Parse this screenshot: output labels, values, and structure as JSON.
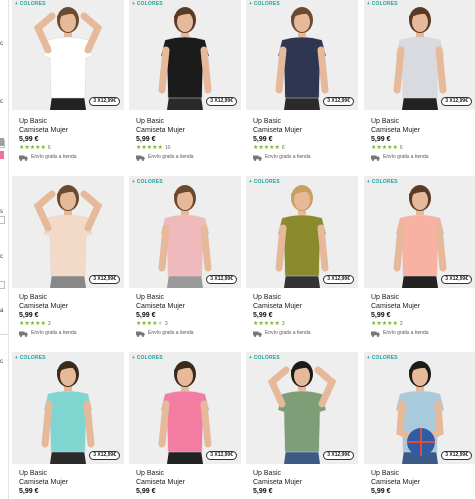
{
  "sidebar": {
    "fragments": [
      {
        "text": "c"
      },
      {
        "text": "c"
      },
      {
        "text": "s"
      },
      {
        "text": "c"
      },
      {
        "text": "a"
      },
      {
        "text": "c"
      }
    ],
    "swatches": [
      "#9e9e9e",
      "#f06ea0"
    ]
  },
  "colors": {
    "accent_green": "#7bb32e",
    "colores_teal": "#1aa6a0",
    "photo_bg": "#eeeeee"
  },
  "products": [
    {
      "colores": "+ COLORES",
      "badge": "3 X12,99€",
      "brand": "Up Basic",
      "name": "Camiseta Mujer",
      "price": "5,99 €",
      "stars": 5,
      "reviews": "6",
      "shipping": "Envío gratis a tienda",
      "shirt": "#ffffff",
      "pants": "#222222",
      "hair": "#6b4a2f",
      "pose": "arms-up"
    },
    {
      "colores": "+ COLORES",
      "badge": "3 X12,99€",
      "brand": "Up Basic",
      "name": "Camiseta Mujer",
      "price": "5,99 €",
      "stars": 5,
      "reviews": "10",
      "shipping": "Envío gratis a tienda",
      "shirt": "#1b1b1b",
      "pants": "#2a2a2a",
      "hair": "#5a3a24",
      "pose": "side"
    },
    {
      "colores": "+ COLORES",
      "badge": "3 X12,99€",
      "brand": "Up Basic",
      "name": "Camiseta Mujer",
      "price": "5,99 €",
      "stars": 5,
      "reviews": "6",
      "shipping": "Envío gratis a tienda",
      "shirt": "#2e3652",
      "pants": "#2a2a2a",
      "hair": "#6b4a2f",
      "pose": "front"
    },
    {
      "colores": "+ COLORES",
      "badge": "3 X12,99€",
      "brand": "Up Basic",
      "name": "Camiseta Mujer",
      "price": "5,99 €",
      "stars": 5,
      "reviews": "6",
      "shipping": "Envío gratis a tienda",
      "shirt": "#d9dadf",
      "pants": "#222222",
      "hair": "#5a3a24",
      "pose": "side"
    },
    {
      "colores": "",
      "badge": "3 X12,99€",
      "brand": "Up Basic",
      "name": "Camiseta Mujer",
      "price": "5,99 €",
      "stars": 5,
      "reviews": "3",
      "shipping": "Envío gratis a tienda",
      "shirt": "#f2d9c8",
      "pants": "#888888",
      "hair": "#6b4a2f",
      "pose": "arms-up"
    },
    {
      "colores": "+ COLORES",
      "badge": "3 X12,99€",
      "brand": "Up Basic",
      "name": "Camiseta Mujer",
      "price": "5,99 €",
      "stars": 4,
      "reviews": "3",
      "shipping": "Envío gratis a tienda",
      "shirt": "#f0b9bc",
      "pants": "#9a9a9a",
      "hair": "#6b4a2f",
      "pose": "front"
    },
    {
      "colores": "+ COLORES",
      "badge": "3 X12,99€",
      "brand": "Up Basic",
      "name": "Camiseta Mujer",
      "price": "5,99 €",
      "stars": 5,
      "reviews": "3",
      "shipping": "Envío gratis a tienda",
      "shirt": "#8b8a2c",
      "pants": "#333333",
      "hair": "#c9a063",
      "pose": "front"
    },
    {
      "colores": "+ COLORES",
      "badge": "3 X12,99€",
      "brand": "Up Basic",
      "name": "Camiseta Mujer",
      "price": "5,99 €",
      "stars": 5,
      "reviews": "2",
      "shipping": "Envío gratis a tienda",
      "shirt": "#f7b2a3",
      "pants": "#222222",
      "hair": "#5a3a24",
      "pose": "front"
    },
    {
      "colores": "+ COLORES",
      "badge": "3 X12,99€",
      "brand": "Up Basic",
      "name": "Camiseta Mujer",
      "price": "5,99 €",
      "stars": 0,
      "reviews": "",
      "shipping": "",
      "shirt": "#7fd6d0",
      "pants": "#2a2a2a",
      "hair": "#3a2a1c",
      "pose": "front"
    },
    {
      "colores": "+ COLORES",
      "badge": "3 X12,99€",
      "brand": "Up Basic",
      "name": "Camiseta Mujer",
      "price": "5,99 €",
      "stars": 0,
      "reviews": "",
      "shipping": "",
      "shirt": "#f37ca2",
      "pants": "#222222",
      "hair": "#3a2a1c",
      "pose": "side"
    },
    {
      "colores": "+ COLORES",
      "badge": "3 X12,99€",
      "brand": "Up Basic",
      "name": "Camiseta Mujer",
      "price": "5,99 €",
      "stars": 0,
      "reviews": "",
      "shipping": "",
      "shirt": "#7d9e76",
      "pants": "#3b5a85",
      "hair": "#1e1a16",
      "pose": "arms-up"
    },
    {
      "colores": "+ COLORES",
      "badge": "3 X12,99€",
      "brand": "Up Basic",
      "name": "Camiseta Mujer",
      "price": "5,99 €",
      "stars": 0,
      "reviews": "",
      "shipping": "",
      "shirt": "#a9c9dc",
      "pants": "#3b5a85",
      "hair": "#1e1a16",
      "pose": "ball"
    }
  ]
}
